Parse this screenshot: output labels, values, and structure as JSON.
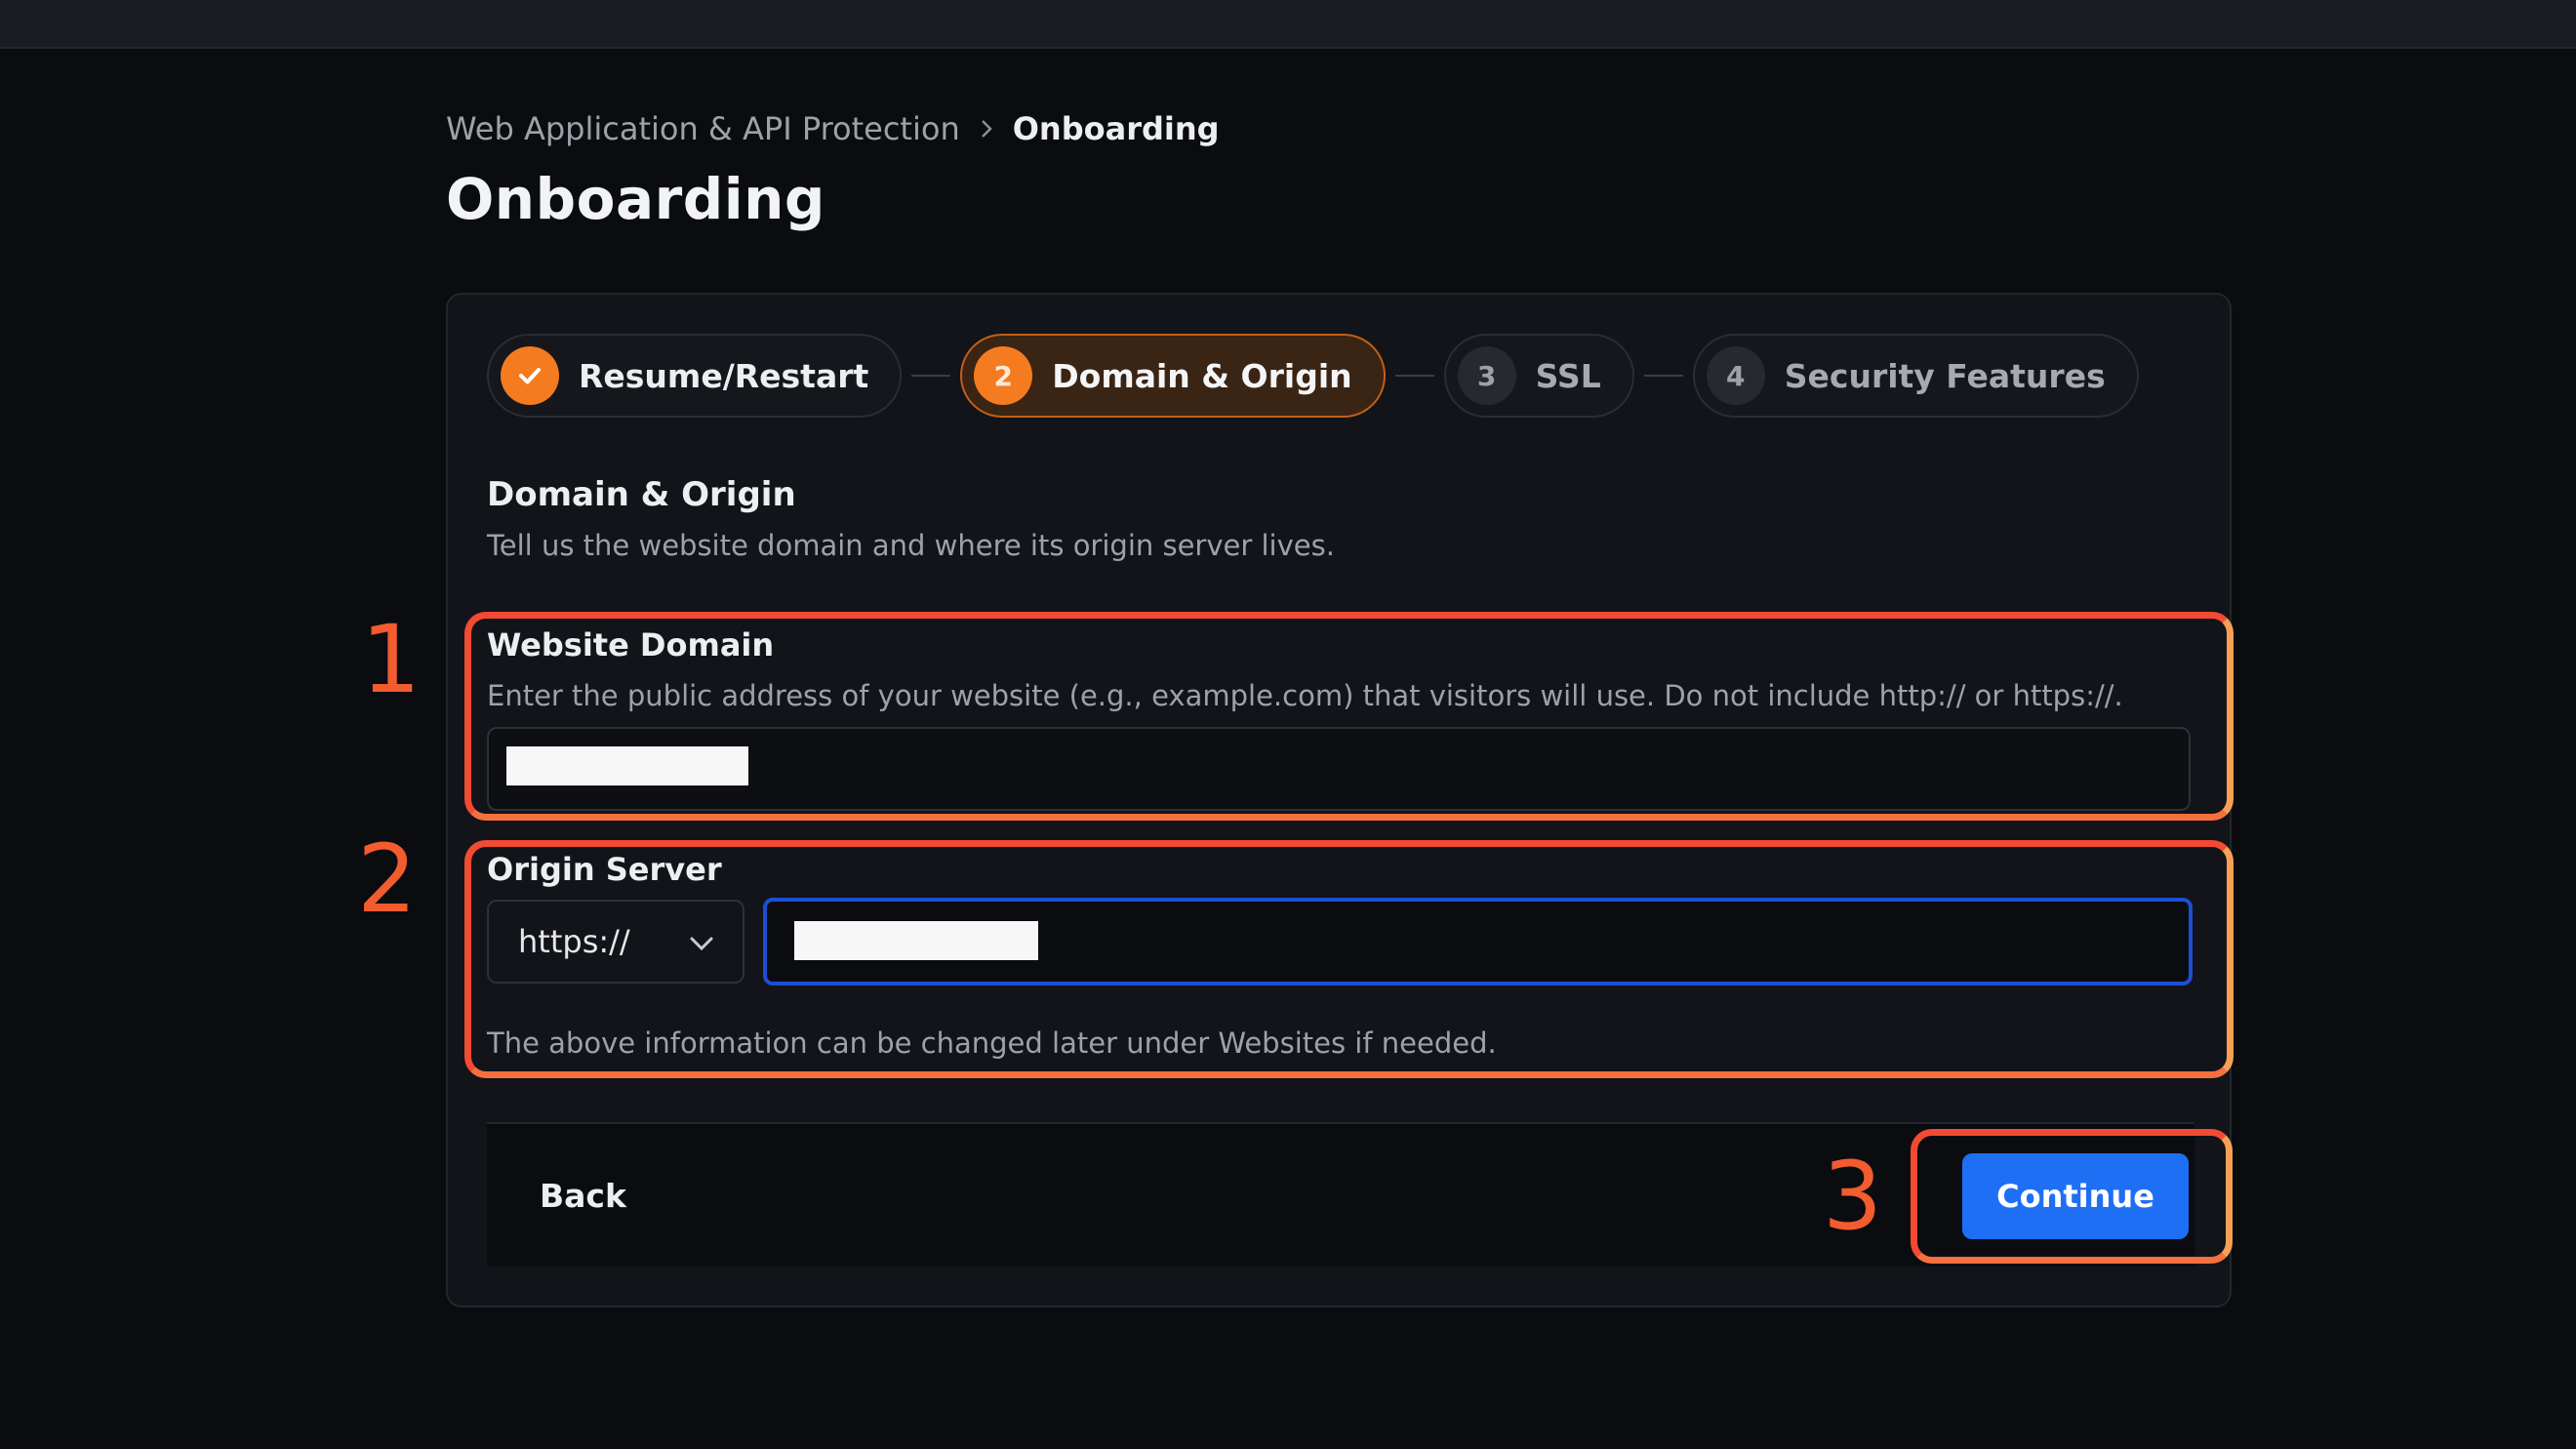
{
  "breadcrumb": {
    "parent": "Web Application & API Protection",
    "current": "Onboarding"
  },
  "page": {
    "title": "Onboarding"
  },
  "stepper": {
    "steps": [
      {
        "number": "",
        "label": "Resume/Restart",
        "state": "done",
        "icon": "check-icon"
      },
      {
        "number": "2",
        "label": "Domain & Origin",
        "state": "active"
      },
      {
        "number": "3",
        "label": "SSL",
        "state": "pending"
      },
      {
        "number": "4",
        "label": "Security Features",
        "state": "pending"
      }
    ]
  },
  "section": {
    "title": "Domain & Origin",
    "description": "Tell us the website domain and where its origin server lives."
  },
  "website_domain": {
    "label": "Website Domain",
    "help": "Enter the public address of your website (e.g., example.com) that visitors will use. Do not include http:// or https://.",
    "value": ""
  },
  "origin_server": {
    "label": "Origin Server",
    "protocol": "https://",
    "value": "",
    "note": "The above information can be changed later under Websites if needed."
  },
  "footer": {
    "back_label": "Back",
    "continue_label": "Continue"
  },
  "annotations": [
    "1",
    "2",
    "3"
  ],
  "colors": {
    "accent_orange": "#f47b1f",
    "primary_blue": "#1f6ff5",
    "annotation_red": "#f24a33"
  }
}
